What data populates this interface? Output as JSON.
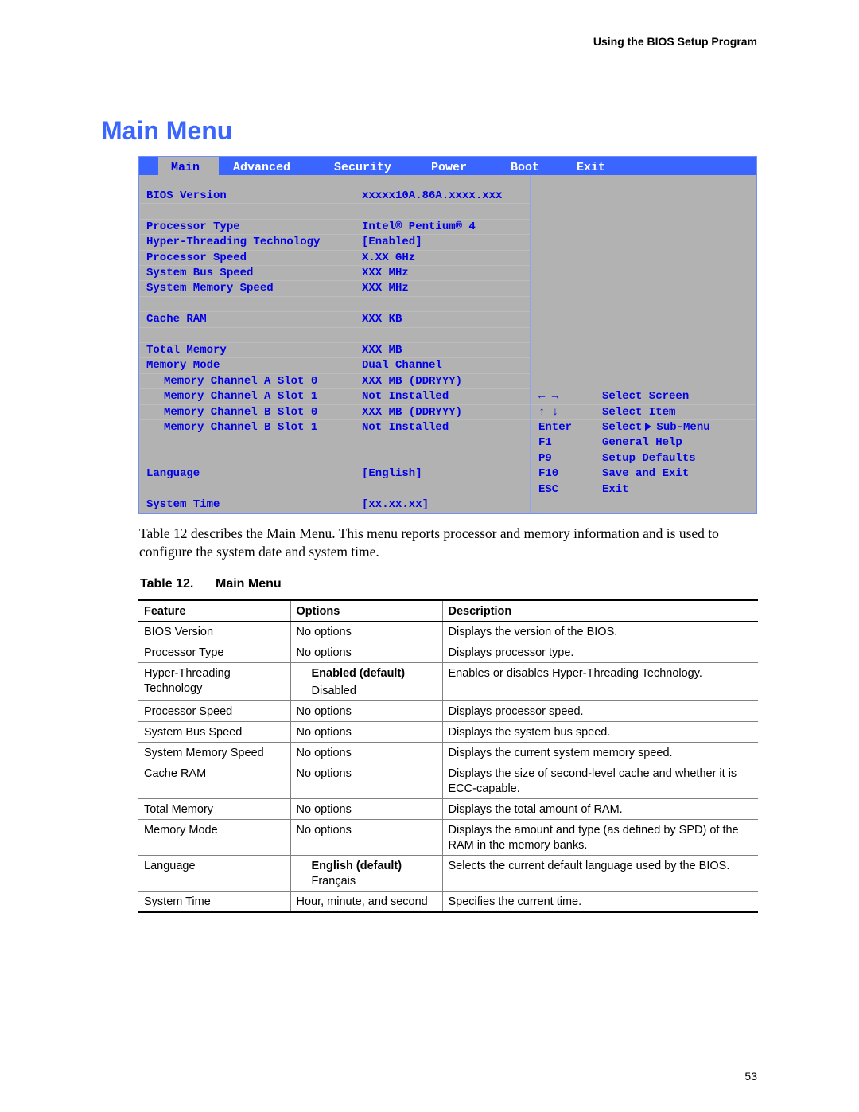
{
  "running_header": "Using the BIOS Setup Program",
  "page_title": "Main Menu",
  "bios_screen": {
    "tabs": [
      {
        "label": "Main",
        "active": true
      },
      {
        "label": "Advanced",
        "active": false
      },
      {
        "label": "Security",
        "active": false
      },
      {
        "label": "Power",
        "active": false
      },
      {
        "label": "Boot",
        "active": false
      },
      {
        "label": "Exit",
        "active": false
      }
    ],
    "rows": [
      {
        "label": "BIOS Version",
        "value": "xxxxx10A.86A.xxxx.xxx"
      },
      {
        "label": "",
        "value": ""
      },
      {
        "label": "Processor Type",
        "value": "Intel® Pentium® 4"
      },
      {
        "label": "Hyper-Threading Technology",
        "value": "[Enabled]"
      },
      {
        "label": "Processor Speed",
        "value": "X.XX GHz"
      },
      {
        "label": "System Bus Speed",
        "value": "XXX MHz"
      },
      {
        "label": "System Memory Speed",
        "value": "XXX MHz"
      },
      {
        "label": "",
        "value": ""
      },
      {
        "label": "Cache RAM",
        "value": "XXX KB"
      },
      {
        "label": "",
        "value": ""
      },
      {
        "label": "Total Memory",
        "value": "XXX MB"
      },
      {
        "label": "Memory Mode",
        "value": "Dual Channel"
      },
      {
        "label": "Memory Channel A Slot 0",
        "value": "XXX MB (DDRYYY)"
      },
      {
        "label": "Memory Channel A Slot 1",
        "value": "Not Installed"
      },
      {
        "label": "Memory Channel B Slot 0",
        "value": "XXX MB (DDRYYY)"
      },
      {
        "label": "Memory Channel B Slot 1",
        "value": "Not Installed"
      },
      {
        "label": "",
        "value": ""
      },
      {
        "label": "",
        "value": ""
      },
      {
        "label": "Language",
        "value": "[English]"
      },
      {
        "label": "",
        "value": ""
      },
      {
        "label": "System Time",
        "value": "[xx.xx.xx]"
      }
    ],
    "key_help": [
      {
        "key": "← →",
        "desc": "Select Screen"
      },
      {
        "key": "↑ ↓",
        "desc": "Select Item"
      },
      {
        "key": "Enter",
        "desc_before": "Select",
        "desc_after": "Sub-Menu"
      },
      {
        "key": "F1",
        "desc": "General Help"
      },
      {
        "key": "P9",
        "desc": "Setup Defaults"
      },
      {
        "key": "F10",
        "desc": "Save and Exit"
      },
      {
        "key": "ESC",
        "desc": "Exit"
      }
    ]
  },
  "paragraph": "Table 12 describes the Main Menu.  This menu reports processor and memory information and is used to configure the system date and system time.",
  "table_caption": {
    "number": "Table 12.",
    "title": "Main Menu"
  },
  "table": {
    "headers": [
      "Feature",
      "Options",
      "Description"
    ],
    "rows": [
      {
        "feature": "BIOS Version",
        "options": "No options",
        "description": "Displays the version of the BIOS."
      },
      {
        "feature": "Processor Type",
        "options": "No options",
        "description": "Displays processor type."
      },
      {
        "feature": "Hyper-Threading Technology",
        "option_default": "Enabled (default)",
        "option_alt": "Disabled",
        "description": "Enables or disables Hyper-Threading Technology."
      },
      {
        "feature": "Processor Speed",
        "options": "No options",
        "description": "Displays processor speed."
      },
      {
        "feature": "System Bus Speed",
        "options": "No options",
        "description": "Displays the system bus speed."
      },
      {
        "feature": "System Memory Speed",
        "options": "No options",
        "description": "Displays the current system memory speed."
      },
      {
        "feature": "Cache RAM",
        "options": "No options",
        "description": "Displays the size of second-level cache and whether it is ECC-capable."
      },
      {
        "feature": "Total Memory",
        "options": "No options",
        "description": "Displays the total amount of RAM."
      },
      {
        "feature": "Memory Mode",
        "options": "No options",
        "description": "Displays the amount and type (as defined by SPD) of the RAM in the memory banks."
      },
      {
        "feature": "Language",
        "option_default": "English (default)",
        "option_alt": "Français",
        "description": "Selects the current default language used by the BIOS."
      },
      {
        "feature": "System Time",
        "options": "Hour, minute, and second",
        "description": "Specifies the current time."
      }
    ]
  },
  "page_number": "53"
}
